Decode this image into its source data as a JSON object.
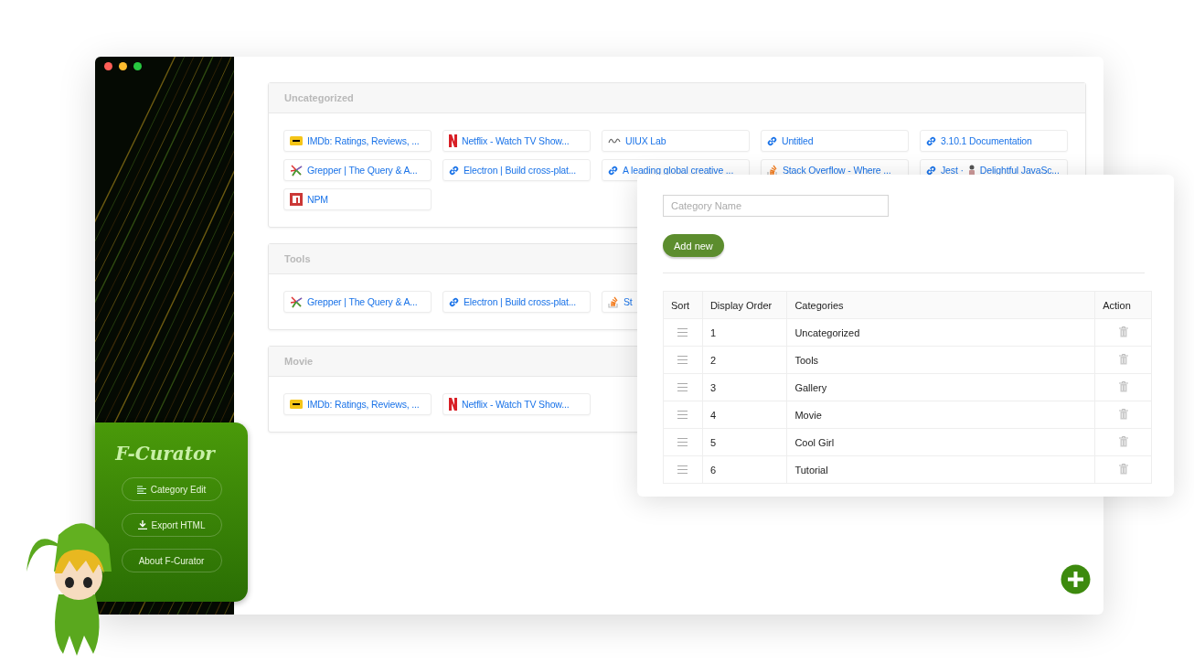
{
  "categories": [
    {
      "title": "Uncategorized",
      "links": [
        {
          "kind": "imdb",
          "text": "IMDb: Ratings, Reviews, ..."
        },
        {
          "kind": "netflix",
          "text": "Netflix - Watch TV Show..."
        },
        {
          "kind": "uiux",
          "text": "UIUX Lab"
        },
        {
          "kind": "link",
          "text": "Untitled"
        },
        {
          "kind": "link",
          "text": "3.10.1 Documentation"
        },
        {
          "kind": "grepper",
          "text": "Grepper | The Query & A..."
        },
        {
          "kind": "link",
          "text": "Electron | Build cross-plat..."
        },
        {
          "kind": "link",
          "text": "A leading global creative ..."
        },
        {
          "kind": "stack",
          "text": "Stack Overflow - Where ..."
        },
        {
          "kind": "link",
          "text_parts": [
            "Jest ·",
            "Delightful JavaSc..."
          ]
        },
        {
          "kind": "npm",
          "text": "NPM"
        }
      ]
    },
    {
      "title": "Tools",
      "links": [
        {
          "kind": "grepper",
          "text": "Grepper | The Query & A..."
        },
        {
          "kind": "link",
          "text": "Electron | Build cross-plat..."
        },
        {
          "kind": "stack",
          "text": "St"
        }
      ]
    },
    {
      "title": "Movie",
      "links": [
        {
          "kind": "imdb",
          "text": "IMDb: Ratings, Reviews, ..."
        },
        {
          "kind": "netflix",
          "text": "Netflix - Watch TV Show..."
        }
      ]
    }
  ],
  "menu": {
    "title": "F-Curator",
    "buttons": [
      {
        "kind": "list",
        "label": "Category Edit"
      },
      {
        "kind": "download",
        "label": "Export HTML"
      },
      {
        "kind": "plain",
        "label": "About F-Curator"
      }
    ]
  },
  "editor": {
    "placeholder": "Category Name",
    "add_button": "Add new",
    "columns": [
      "Sort",
      "Display Order",
      "Categories",
      "Action"
    ],
    "rows": [
      {
        "order": "1",
        "name": "Uncategorized"
      },
      {
        "order": "2",
        "name": "Tools"
      },
      {
        "order": "3",
        "name": "Gallery"
      },
      {
        "order": "4",
        "name": "Movie"
      },
      {
        "order": "5",
        "name": "Cool Girl"
      },
      {
        "order": "6",
        "name": "Tutorial"
      }
    ]
  }
}
